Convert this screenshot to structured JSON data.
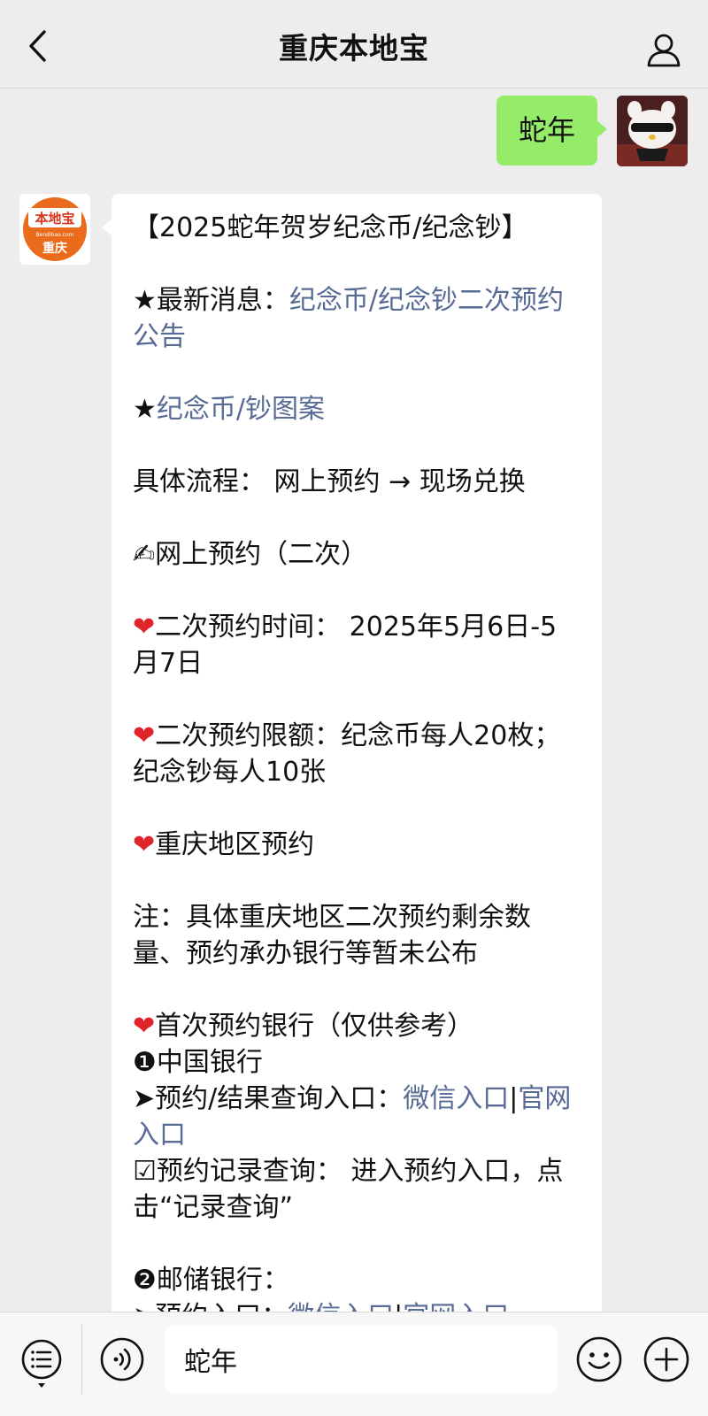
{
  "nav": {
    "title": "重庆本地宝",
    "back_icon": "chevron-left-icon",
    "profile_icon": "person-icon"
  },
  "outgoing": {
    "text": "蛇年"
  },
  "logo": {
    "brand": "本地宝",
    "site": "Bendibao.com",
    "city": "重庆"
  },
  "article": {
    "headline": "【2025蛇年贺岁纪念币/纪念钞】",
    "news_prefix": "★最新消息：",
    "news_link": "纪念币/纪念钞二次预约公告",
    "pattern_prefix": "★",
    "pattern_link": "纪念币/钞图案",
    "process": "具体流程：  网上预约 → 现场兑换",
    "online_reservation": "✍网上预约（二次）",
    "heart": "❤",
    "second_time": "二次预约时间： 2025年5月6日-5月7日",
    "second_limit": "二次预约限额：纪念币每人20枚；纪念钞每人10张",
    "cq_reservation": "重庆地区预约",
    "note": "注：具体重庆地区二次预约剩余数量、预约承办银行等暂未公布",
    "first_banks": "首次预约银行（仅供参考）",
    "boc_title": "❶中国银行",
    "boc_entry_prefix": "➤预约/结果查询入口：",
    "boc_wechat_link": "微信入口",
    "separator": "|",
    "boc_official_link": "官网入口",
    "boc_record": "☑预约记录查询： 进入预约入口，点击“记录查询”",
    "psbc_title": "❷邮储银行：",
    "psbc_entry_prefix": "➤预约入口：",
    "psbc_wechat_link": "微信入口",
    "psbc_official_link": "官网入口"
  },
  "inputbar": {
    "menu_icon": "menu-list-icon",
    "voice_icon": "voice-icon",
    "input_value": "蛇年",
    "emoji_icon": "emoji-icon",
    "plus_icon": "plus-icon"
  },
  "colors": {
    "background": "#ededed",
    "outgoing_bubble": "#95ec69",
    "link": "#576b95",
    "heart": "#e0242b",
    "logo_orange": "#ea6b1b"
  }
}
